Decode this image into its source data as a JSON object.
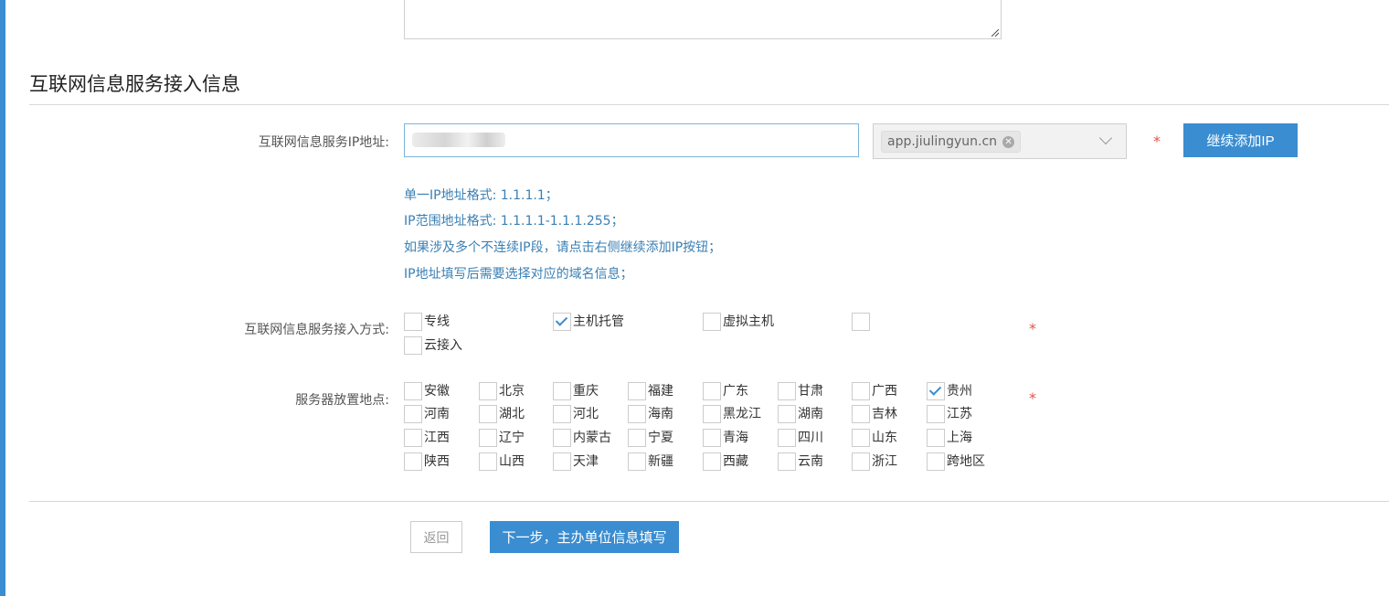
{
  "section": {
    "title": "互联网信息服务接入信息"
  },
  "ip": {
    "label": "互联网信息服务IP地址:",
    "domain_tag": "app.jiulingyun.cn",
    "add_button": "继续添加IP",
    "required_mark": "*",
    "hints": [
      "单一IP地址格式: 1.1.1.1；",
      "IP范围地址格式: 1.1.1.1-1.1.1.255；",
      "如果涉及多个不连续IP段，请点击右侧继续添加IP按钮；",
      "IP地址填写后需要选择对应的域名信息；"
    ]
  },
  "access": {
    "label": "互联网信息服务接入方式:",
    "required_mark": "*",
    "options": [
      {
        "label": "专线",
        "checked": false
      },
      {
        "label": "主机托管",
        "checked": true
      },
      {
        "label": "虚拟主机",
        "checked": false
      },
      {
        "label": "",
        "checked": false
      },
      {
        "label": "云接入",
        "checked": false
      }
    ]
  },
  "location": {
    "label": "服务器放置地点:",
    "required_mark": "*",
    "options": [
      {
        "label": "安徽",
        "checked": false
      },
      {
        "label": "北京",
        "checked": false
      },
      {
        "label": "重庆",
        "checked": false
      },
      {
        "label": "福建",
        "checked": false
      },
      {
        "label": "广东",
        "checked": false
      },
      {
        "label": "甘肃",
        "checked": false
      },
      {
        "label": "广西",
        "checked": false
      },
      {
        "label": "贵州",
        "checked": true
      },
      {
        "label": "河南",
        "checked": false
      },
      {
        "label": "湖北",
        "checked": false
      },
      {
        "label": "河北",
        "checked": false
      },
      {
        "label": "海南",
        "checked": false
      },
      {
        "label": "黑龙江",
        "checked": false
      },
      {
        "label": "湖南",
        "checked": false
      },
      {
        "label": "吉林",
        "checked": false
      },
      {
        "label": "江苏",
        "checked": false
      },
      {
        "label": "江西",
        "checked": false
      },
      {
        "label": "辽宁",
        "checked": false
      },
      {
        "label": "内蒙古",
        "checked": false
      },
      {
        "label": "宁夏",
        "checked": false
      },
      {
        "label": "青海",
        "checked": false
      },
      {
        "label": "四川",
        "checked": false
      },
      {
        "label": "山东",
        "checked": false
      },
      {
        "label": "上海",
        "checked": false
      },
      {
        "label": "陕西",
        "checked": false
      },
      {
        "label": "山西",
        "checked": false
      },
      {
        "label": "天津",
        "checked": false
      },
      {
        "label": "新疆",
        "checked": false
      },
      {
        "label": "西藏",
        "checked": false
      },
      {
        "label": "云南",
        "checked": false
      },
      {
        "label": "浙江",
        "checked": false
      },
      {
        "label": "跨地区",
        "checked": false
      }
    ]
  },
  "footer": {
    "back_button": "返回",
    "next_button": "下一步，主办单位信息填写"
  },
  "colors": {
    "accent": "#3a8dd0",
    "required": "#e4534b",
    "hint": "#3a7fb3"
  }
}
